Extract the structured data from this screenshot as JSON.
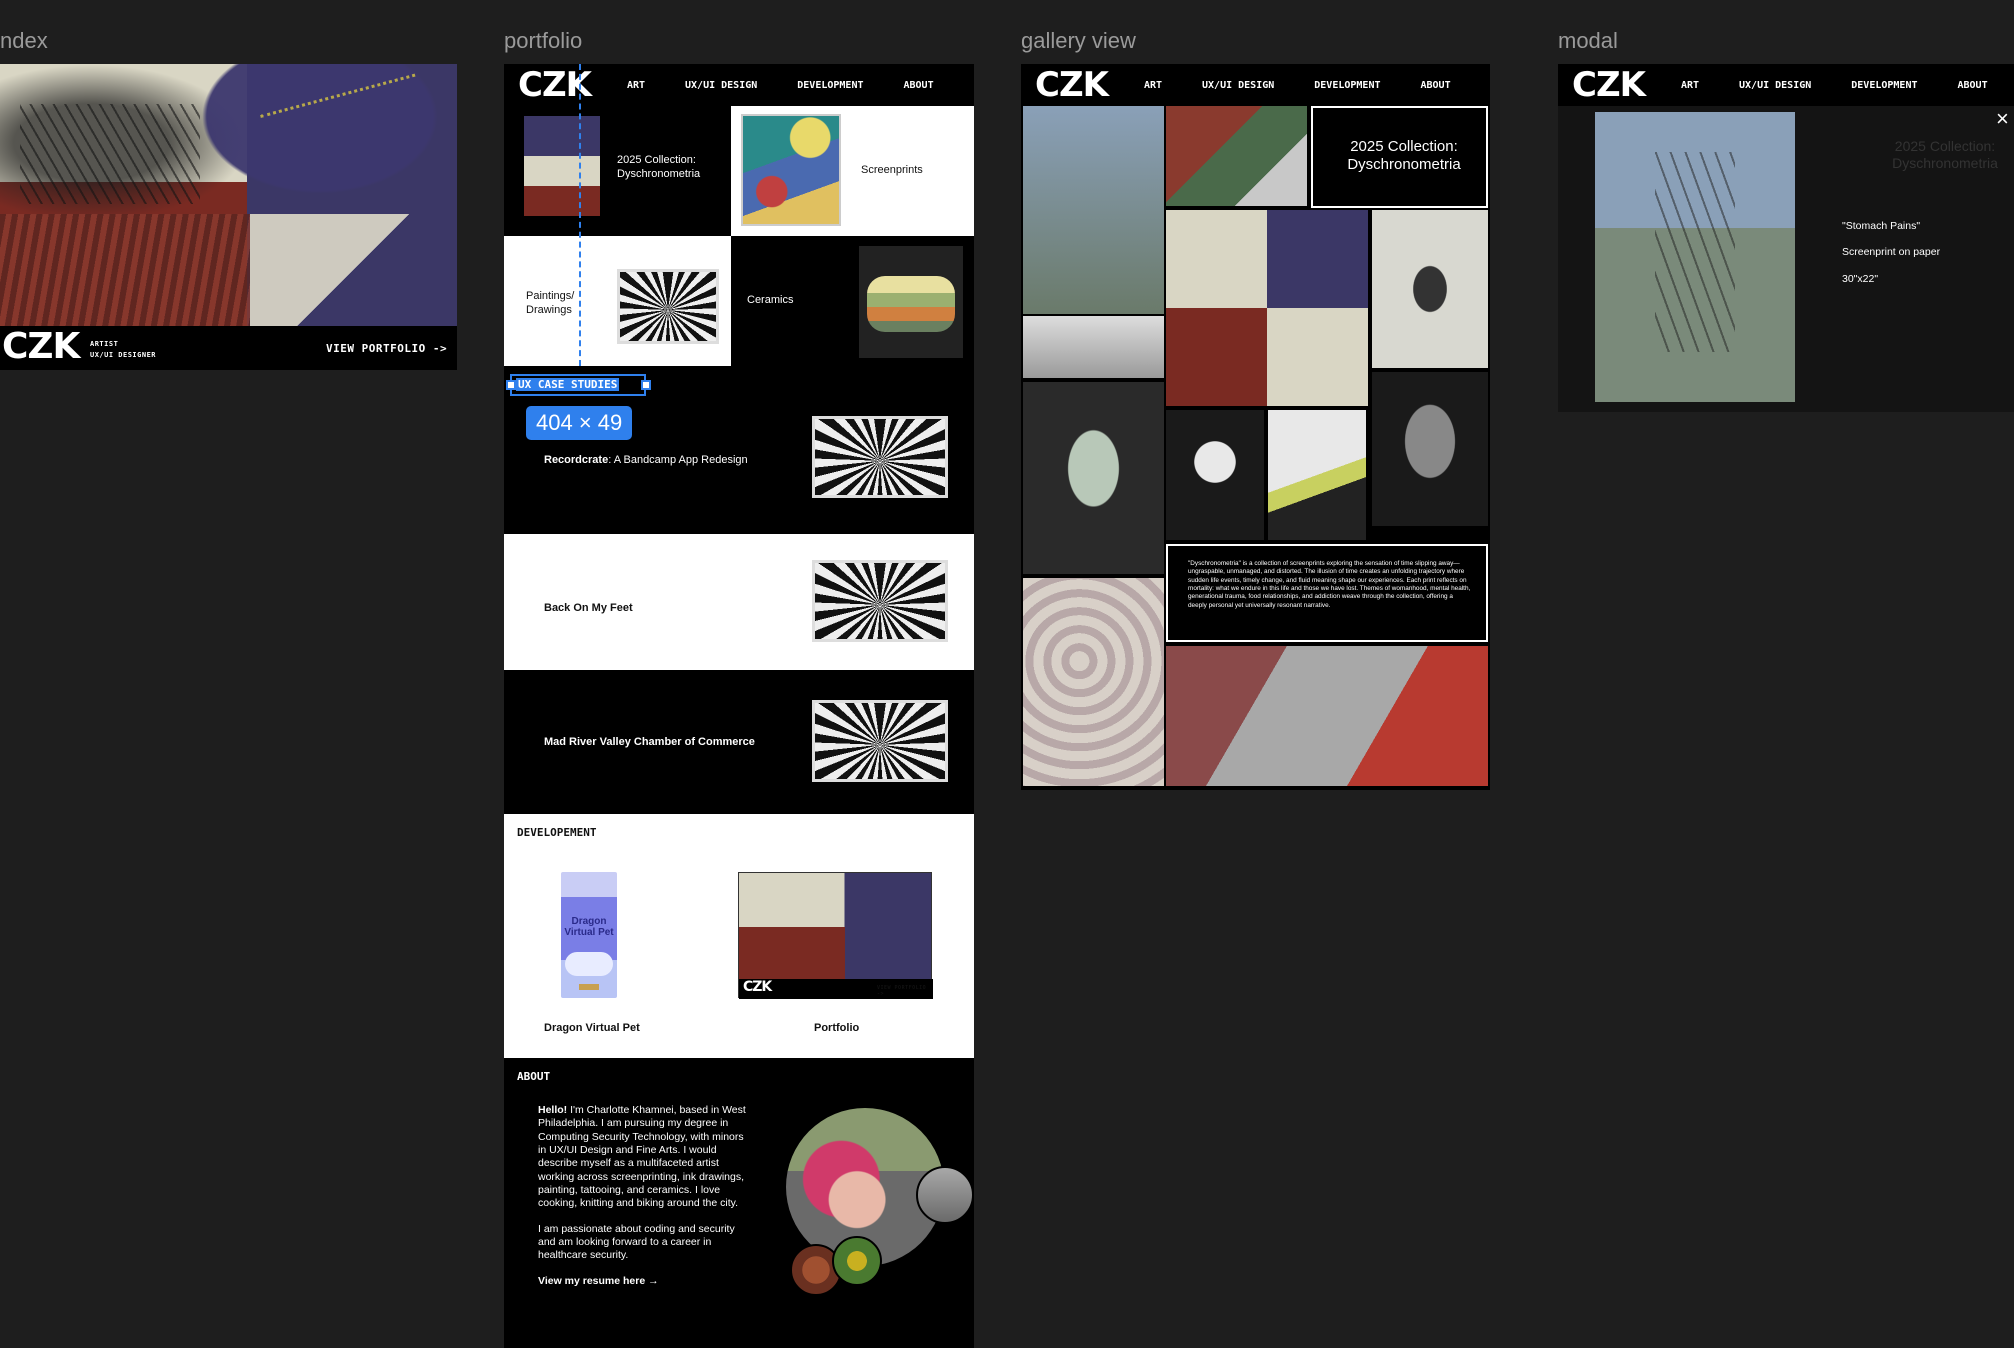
{
  "frames": {
    "index": "ndex",
    "portfolio": "portfolio",
    "gallery": "gallery view",
    "modal": "modal"
  },
  "brand": {
    "logo": "CZK"
  },
  "index_page": {
    "role_line1": "ARTIST",
    "role_line2": "UX/UI DESIGNER",
    "cta": "VIEW PORTFOLIO ->"
  },
  "nav": {
    "items": [
      "ART",
      "UX/UI DESIGN",
      "DEVELOPMENT",
      "ABOUT"
    ]
  },
  "portfolio": {
    "art_tiles": {
      "collection": "2025 Collection: Dyschronometria",
      "screenprints": "Screenprints",
      "paintings": "Paintings/ Drawings",
      "ceramics": "Ceramics"
    },
    "case_heading": "UX CASE STUDIES",
    "selection_size": "404 × 49",
    "case_studies": [
      {
        "title_bold": "Recordcrate",
        "title_rest": ": A Bandcamp App Redesign"
      },
      {
        "title_bold": "Back On My Feet",
        "title_rest": ""
      },
      {
        "title_bold": "Mad River Valley Chamber of Commerce",
        "title_rest": ""
      }
    ],
    "dev_heading": "DEVELOPEMENT",
    "dev_items": [
      {
        "label": "Dragon Virtual Pet",
        "thumb_text": "Dragon Virtual Pet"
      },
      {
        "label": "Portfolio"
      }
    ],
    "about_heading": "ABOUT",
    "about_hello": "Hello!",
    "about_p1": " I'm Charlotte Khamnei, based in West Philadelphia. I am pursuing my degree in Computing Security Technology, with minors in UX/UI Design and Fine Arts. I would describe myself as a multifaceted artist working across screenprinting, ink drawings, painting, tattooing, and ceramics. I love cooking, knitting and biking around the city.",
    "about_p2": "I am passionate about coding and security and am looking forward to a career in healthcare security.",
    "resume_link": "View my resume here →"
  },
  "gallery": {
    "collection_title": "2025 Collection: Dyschronometria",
    "description": "\"Dyschronometria\" is a collection of screenprints exploring the sensation of time slipping away—ungraspable, unmanaged, and distorted. The illusion of time creates an unfolding trajectory where sudden life events, timely change, and fluid meaning shape our experiences. Each print reflects on mortality: what we endure in this life and those we have lost. Themes of womanhood, mental health, generational trauma, food relationships, and addiction weave through the collection, offering a deeply personal yet universally resonant narrative."
  },
  "modal": {
    "faded_title": "2025 Collection: Dyschronometria",
    "artwork_title": "\"Stomach Pains\"",
    "medium": "Screenprint on paper",
    "dimensions": "30\"x22\"",
    "close_glyph": "×"
  },
  "colors": {
    "canvas": "#1e1e1e",
    "selection_blue": "#2f80ed",
    "print_purple": "#3b3766",
    "print_cream": "#e8e4cf",
    "print_red": "#7a2a22"
  }
}
